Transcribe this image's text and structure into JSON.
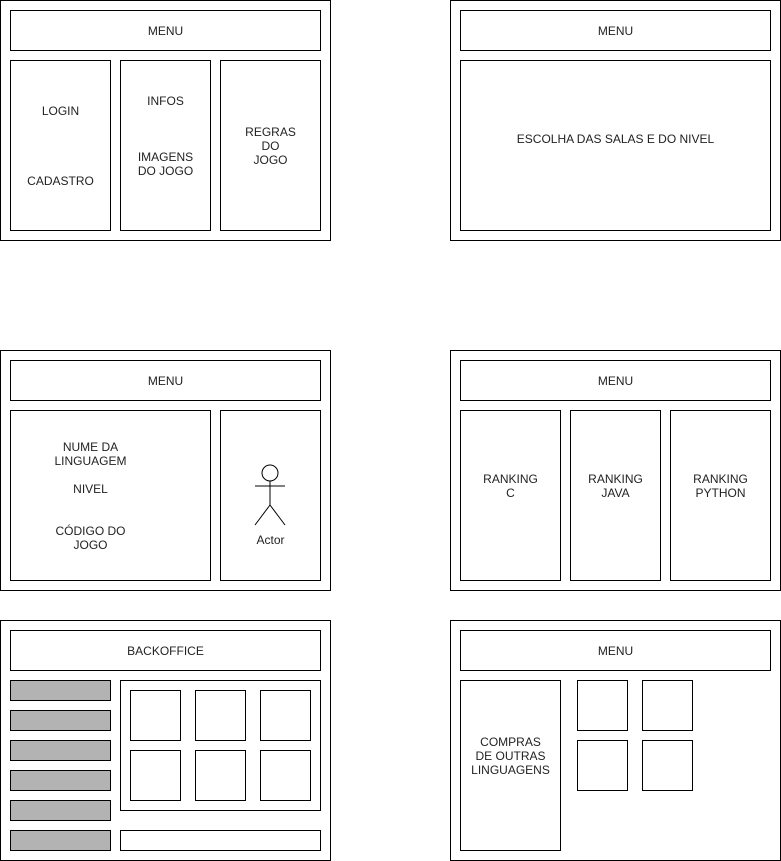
{
  "wireframe1": {
    "menu": "MENU",
    "col1": {
      "login": "LOGIN",
      "cadastro": "CADASTRO"
    },
    "col2": {
      "infos": "INFOS",
      "imagens": "IMAGENS\nDO JOGO"
    },
    "col3": {
      "regras": "REGRAS\nDO\nJOGO"
    }
  },
  "wireframe2": {
    "menu": "MENU",
    "content": "ESCOLHA DAS SALAS E DO NIVEL"
  },
  "wireframe3": {
    "menu": "MENU",
    "left": {
      "linguagem": "NUME DA\nLINGUAGEM",
      "nivel": "NIVEL",
      "codigo": "CÓDIGO DO\nJOGO"
    },
    "actor": "Actor"
  },
  "wireframe4": {
    "menu": "MENU",
    "rankings": [
      "RANKING\nC",
      "RANKING\nJAVA",
      "RANKING\nPYTHON"
    ]
  },
  "wireframe5": {
    "menu": "BACKOFFICE"
  },
  "wireframe6": {
    "menu": "MENU",
    "compras": "COMPRAS\nDE OUTRAS\nLINGUAGENS"
  }
}
